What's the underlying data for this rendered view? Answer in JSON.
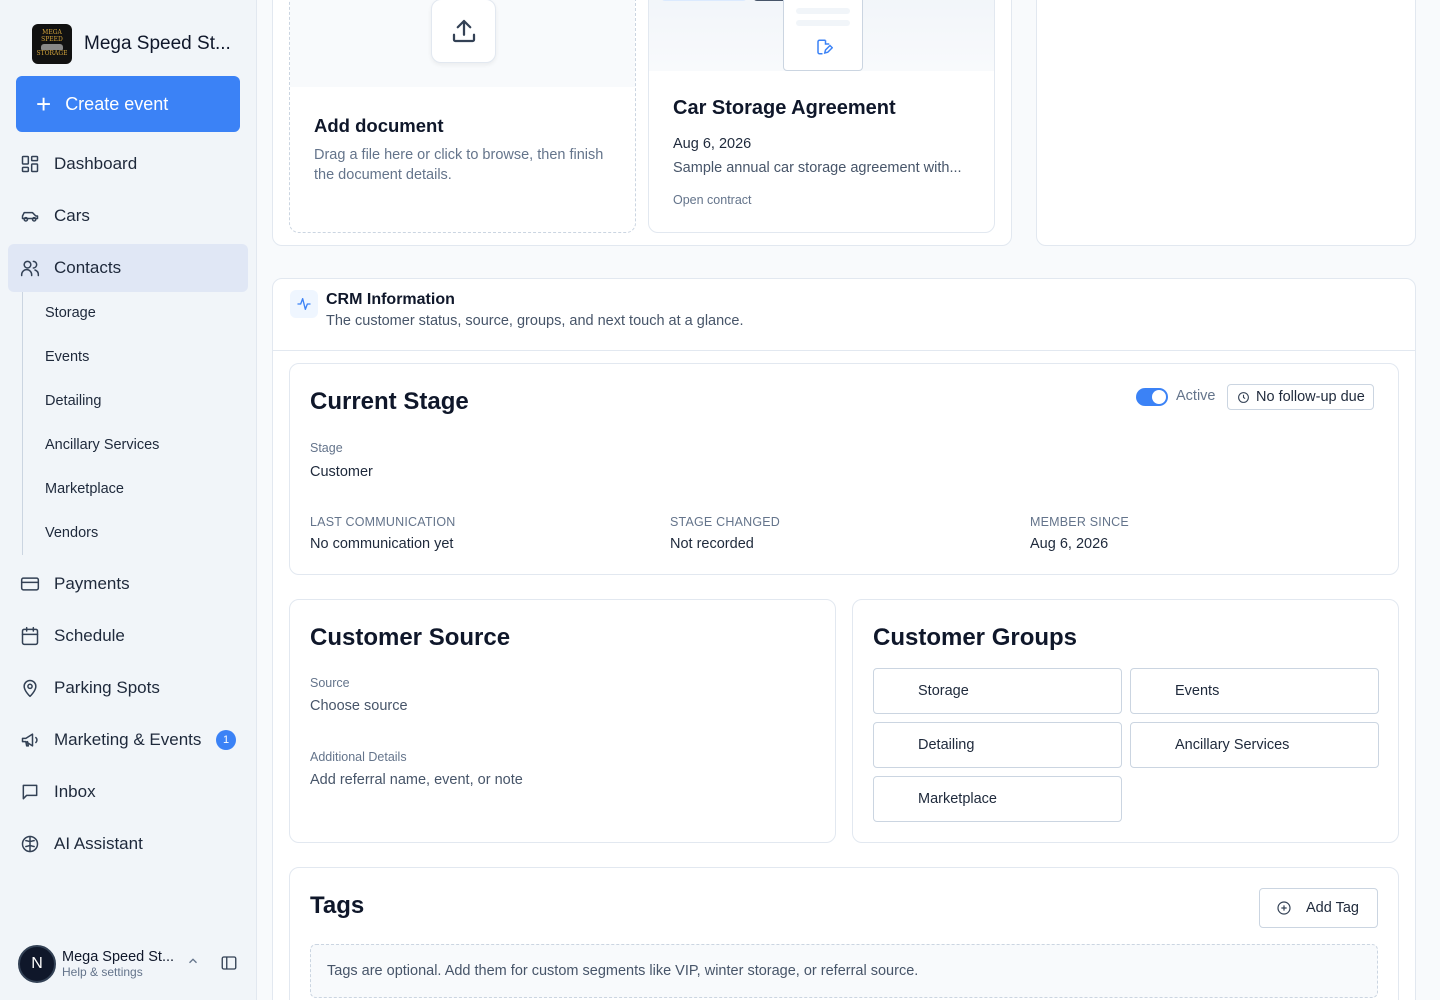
{
  "sidebar": {
    "brand": {
      "name": "Mega Speed St...",
      "logo_text_1": "MEGA SPEED",
      "logo_text_2": "STORAGE"
    },
    "create_button": "Create event",
    "nav": [
      {
        "label": "Dashboard",
        "icon": "dashboard-icon"
      },
      {
        "label": "Cars",
        "icon": "car-icon"
      },
      {
        "label": "Contacts",
        "icon": "users-icon"
      },
      {
        "label": "Payments",
        "icon": "credit-card-icon"
      },
      {
        "label": "Schedule",
        "icon": "calendar-icon"
      },
      {
        "label": "Parking Spots",
        "icon": "map-pin-icon"
      },
      {
        "label": "Marketing & Events",
        "icon": "megaphone-icon",
        "badge": "1"
      },
      {
        "label": "Inbox",
        "icon": "message-square-icon"
      },
      {
        "label": "AI Assistant",
        "icon": "brain-icon"
      }
    ],
    "subnav": [
      "Storage",
      "Events",
      "Detailing",
      "Ancillary Services",
      "Marketplace",
      "Vendors"
    ],
    "user": {
      "initial": "N",
      "name": "Mega Speed St...",
      "subtitle": "Help & settings"
    }
  },
  "documents": {
    "upload": {
      "title": "Add document",
      "description": "Drag a file here or click to browse, then finish the document details."
    },
    "contract": {
      "title": "Car Storage Agreement",
      "date": "Aug 6, 2026",
      "description": "Sample annual car storage agreement with...",
      "link": "Open contract"
    }
  },
  "crm": {
    "title": "CRM Information",
    "subtitle": "The customer status, source, groups, and next touch at a glance.",
    "current_stage": {
      "heading": "Current Stage",
      "active_label": "Active",
      "followup_label": "No follow-up due",
      "stage_label": "Stage",
      "stage_value": "Customer",
      "last_comm_label": "LAST COMMUNICATION",
      "last_comm_value": "No communication yet",
      "stage_changed_label": "STAGE CHANGED",
      "stage_changed_value": "Not recorded",
      "member_since_label": "MEMBER SINCE",
      "member_since_value": "Aug 6, 2026"
    },
    "source": {
      "heading": "Customer Source",
      "source_label": "Source",
      "source_placeholder": "Choose source",
      "details_label": "Additional Details",
      "details_placeholder": "Add referral name, event, or note"
    },
    "groups": {
      "heading": "Customer Groups",
      "items": [
        "Storage",
        "Events",
        "Detailing",
        "Ancillary Services",
        "Marketplace"
      ]
    },
    "tags": {
      "heading": "Tags",
      "add_button": "Add Tag",
      "note": "Tags are optional. Add them for custom segments like VIP, winter storage, or referral source."
    }
  },
  "colors": {
    "accent": "#3b82f6",
    "active_nav_bg": "#e0e7f5"
  }
}
